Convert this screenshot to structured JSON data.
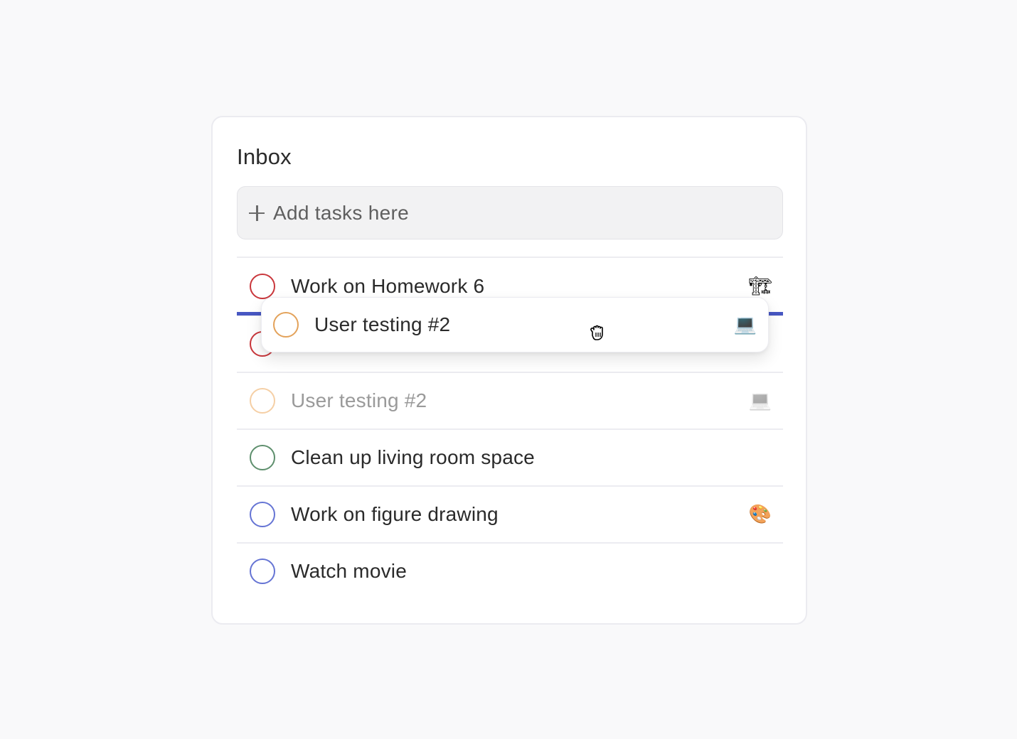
{
  "header": {
    "title": "Inbox"
  },
  "add_task": {
    "placeholder": "Add tasks here",
    "icon": "plus-icon"
  },
  "tasks": [
    {
      "label": "Work on Homework 6",
      "priority_color": "#c9363b",
      "emoji": "🏗",
      "emoji_name": "construction-crane-icon",
      "state": "normal"
    },
    {
      "label": "",
      "priority_color": "#c9363b",
      "emoji": "",
      "emoji_name": "pencil-icon",
      "state": "obscured"
    },
    {
      "label": "User testing #2",
      "priority_color": "#f5cfa5",
      "emoji": "💻",
      "emoji_name": "laptop-icon",
      "state": "drag-placeholder"
    },
    {
      "label": "Clean up living room space",
      "priority_color": "#5e8f6d",
      "emoji": "",
      "emoji_name": "",
      "state": "normal"
    },
    {
      "label": "Work on figure drawing",
      "priority_color": "#6574d4",
      "emoji": "🎨",
      "emoji_name": "palette-icon",
      "state": "normal"
    },
    {
      "label": "Watch movie",
      "priority_color": "#6574d4",
      "emoji": "",
      "emoji_name": "",
      "state": "normal"
    }
  ],
  "dragging": {
    "label": "User testing #2",
    "priority_color": "#e3a25a",
    "emoji": "💻",
    "emoji_name": "laptop-icon",
    "cursor": "grab-hand-icon"
  },
  "drop_indicator_color": "#4757c2"
}
